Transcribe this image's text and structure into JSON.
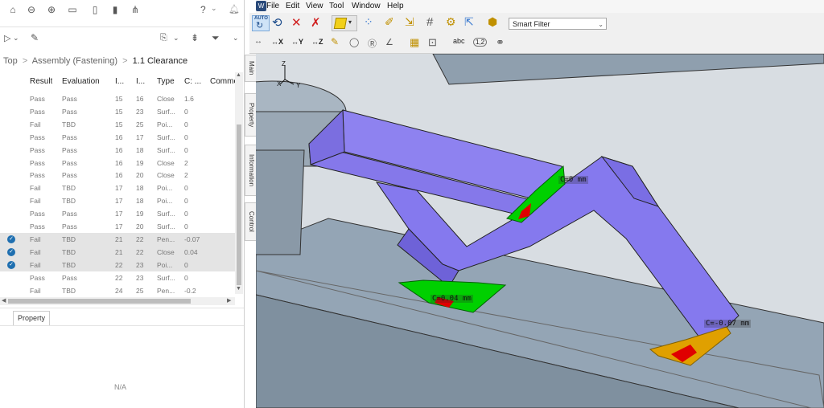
{
  "left_toolbar": {
    "help": "?",
    "icons": [
      "home-icon",
      "zoom-out-icon",
      "zoom-in-icon",
      "window-icon",
      "document-icon",
      "page-icon",
      "tree-icon"
    ]
  },
  "breadcrumb": {
    "items": [
      "Top",
      "Assembly (Fastening)",
      "1.1 Clearance"
    ],
    "separator": ">"
  },
  "table": {
    "headers": [
      "Result",
      "Evaluation",
      "I...",
      "I...",
      "Type",
      "C: ...",
      "Comme"
    ],
    "rows": [
      {
        "result": "Pass",
        "evaluation": "Pass",
        "i1": "15",
        "i2": "16",
        "type": "Close",
        "c": "1.6",
        "selected": false,
        "checked": false
      },
      {
        "result": "Pass",
        "evaluation": "Pass",
        "i1": "15",
        "i2": "23",
        "type": "Surf...",
        "c": "0",
        "selected": false,
        "checked": false
      },
      {
        "result": "Fail",
        "evaluation": "TBD",
        "i1": "15",
        "i2": "25",
        "type": "Poi...",
        "c": "0",
        "selected": false,
        "checked": false
      },
      {
        "result": "Pass",
        "evaluation": "Pass",
        "i1": "16",
        "i2": "17",
        "type": "Surf...",
        "c": "0",
        "selected": false,
        "checked": false
      },
      {
        "result": "Pass",
        "evaluation": "Pass",
        "i1": "16",
        "i2": "18",
        "type": "Surf...",
        "c": "0",
        "selected": false,
        "checked": false
      },
      {
        "result": "Pass",
        "evaluation": "Pass",
        "i1": "16",
        "i2": "19",
        "type": "Close",
        "c": "2",
        "selected": false,
        "checked": false
      },
      {
        "result": "Pass",
        "evaluation": "Pass",
        "i1": "16",
        "i2": "20",
        "type": "Close",
        "c": "2",
        "selected": false,
        "checked": false
      },
      {
        "result": "Fail",
        "evaluation": "TBD",
        "i1": "17",
        "i2": "18",
        "type": "Poi...",
        "c": "0",
        "selected": false,
        "checked": false
      },
      {
        "result": "Fail",
        "evaluation": "TBD",
        "i1": "17",
        "i2": "18",
        "type": "Poi...",
        "c": "0",
        "selected": false,
        "checked": false
      },
      {
        "result": "Pass",
        "evaluation": "Pass",
        "i1": "17",
        "i2": "19",
        "type": "Surf...",
        "c": "0",
        "selected": false,
        "checked": false
      },
      {
        "result": "Pass",
        "evaluation": "Pass",
        "i1": "17",
        "i2": "20",
        "type": "Surf...",
        "c": "0",
        "selected": false,
        "checked": false
      },
      {
        "result": "Fail",
        "evaluation": "TBD",
        "i1": "21",
        "i2": "22",
        "type": "Pen...",
        "c": "-0.07",
        "selected": true,
        "checked": true
      },
      {
        "result": "Fail",
        "evaluation": "TBD",
        "i1": "21",
        "i2": "22",
        "type": "Close",
        "c": "0.04",
        "selected": true,
        "checked": true
      },
      {
        "result": "Fail",
        "evaluation": "TBD",
        "i1": "22",
        "i2": "23",
        "type": "Poi...",
        "c": "0",
        "selected": true,
        "checked": true
      },
      {
        "result": "Pass",
        "evaluation": "Pass",
        "i1": "22",
        "i2": "23",
        "type": "Surf...",
        "c": "0",
        "selected": false,
        "checked": false
      },
      {
        "result": "Fail",
        "evaluation": "TBD",
        "i1": "24",
        "i2": "25",
        "type": "Pen...",
        "c": "-0.2",
        "selected": false,
        "checked": false
      }
    ]
  },
  "property_tab": "Property",
  "property_value": "N/A",
  "side_tabs": [
    "Main",
    "Property",
    "Information",
    "Control"
  ],
  "menu": [
    "File",
    "Edit",
    "View",
    "Tool",
    "Window",
    "Help"
  ],
  "toolbar": {
    "auto_label": "AUTO",
    "smart_filter": "Smart Filter",
    "measure_labels": [
      "X",
      "Y",
      "Z"
    ],
    "abc_label": "abc",
    "num_label": "1,2"
  },
  "viewport": {
    "axes": {
      "x": "X",
      "y": "Y",
      "z": "Z"
    },
    "annotations": [
      "C=0 mm",
      "C=0.04 mm",
      "C=-0.07 mm"
    ]
  },
  "colors": {
    "part_purple": "#8a7df0",
    "base_gray": "#8fa0b0",
    "contact_green": "#00d000",
    "contact_red": "#e00000",
    "contact_orange": "#e0a000",
    "selection_gray": "#e4e4e4",
    "check_blue": "#1f6fb0"
  }
}
